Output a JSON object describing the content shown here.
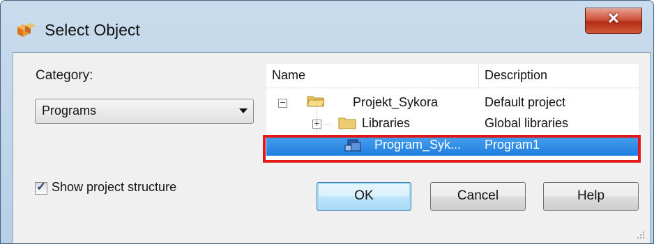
{
  "window": {
    "title": "Select Object",
    "title_icon": "object-cube-icon",
    "close_icon": "close-icon"
  },
  "category": {
    "label": "Category:",
    "selected": "Programs"
  },
  "show_structure": {
    "label": "Show project structure",
    "checked": true
  },
  "tree": {
    "columns": [
      "Name",
      "Description"
    ],
    "rows": [
      {
        "name": "Projekt_Sykora",
        "description": "Default project",
        "icon": "folder-open-icon",
        "expander": "−"
      },
      {
        "name": "Libraries",
        "description": "Global libraries",
        "icon": "folder-icon",
        "expander": "+"
      },
      {
        "name": "Program_Syk...",
        "description": "Program1",
        "icon": "program-icon",
        "selected": true
      }
    ]
  },
  "buttons": {
    "ok": "OK",
    "cancel": "Cancel",
    "help": "Help"
  },
  "colors": {
    "selection": "#3390e8",
    "highlight_box": "#e11919",
    "default_button": "#3c7fb1"
  }
}
